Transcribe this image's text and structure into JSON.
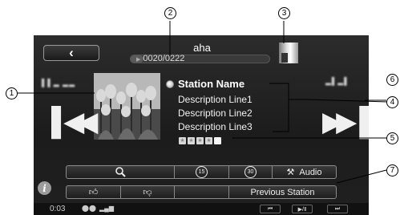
{
  "header": {
    "back_icon": "chevron-left-icon",
    "app_title": "aha",
    "time_position": "0020/0222",
    "progress_fraction": 0.09
  },
  "left_caption": "▌▌▂ ▂▂",
  "right_caption": "▂▌▂▌",
  "station": {
    "name": "Station Name",
    "description_lines": [
      "Description Line1",
      "Description Line2",
      "Description Line3"
    ],
    "rating": 4,
    "max_rating": 5
  },
  "transport": {
    "prev_icon": "skip-back-icon",
    "next_icon": "skip-forward-icon"
  },
  "toolbar_top": {
    "search_icon": "search-icon",
    "rewind_15_label": "15",
    "forward_30_label": "30",
    "audio_label": "Audio"
  },
  "toolbar_bottom": {
    "like_icon": "thumbs-up-icon",
    "dislike_icon": "thumbs-down-icon",
    "previous_station_label": "Previous Station"
  },
  "status_bar": {
    "elapsed": "0:03",
    "mini_prev": "⏮",
    "mini_play_pause": "▶/Ⅱ",
    "mini_next": "⏭"
  },
  "callouts": [
    "1",
    "2",
    "3",
    "4",
    "5",
    "6",
    "7"
  ]
}
